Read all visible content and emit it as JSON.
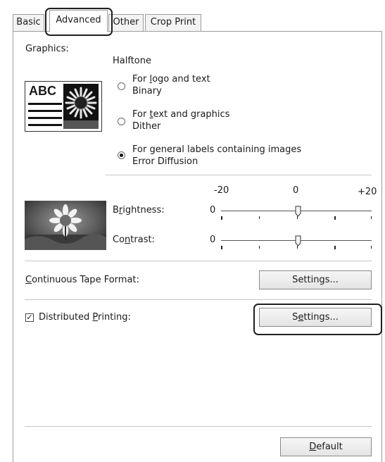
{
  "tabs": [
    {
      "label": "Basic"
    },
    {
      "label": "Advanced"
    },
    {
      "label": "Other"
    },
    {
      "label": "Crop Print"
    }
  ],
  "graphics": {
    "label": "Graphics:",
    "preview_text": "ABC",
    "halftone_label": "Halftone",
    "options": [
      {
        "line1_pre": "For ",
        "line1_mnemonic": "l",
        "line1_post": "ogo and text",
        "line2": "Binary",
        "selected": false
      },
      {
        "line1_pre": "For ",
        "line1_mnemonic": "t",
        "line1_post": "ext and graphics",
        "line2": "Dither",
        "selected": false
      },
      {
        "line1_pre": "For ",
        "line1_mnemonic": "g",
        "line1_post": "eneral labels containing images",
        "line2": "Error Diffusion",
        "selected": true
      }
    ]
  },
  "adjust": {
    "scale_min": "-20",
    "scale_mid": "0",
    "scale_max": "+20",
    "brightness": {
      "label_pre": "B",
      "label_mnemonic": "r",
      "label_post": "ightness:",
      "value": "0",
      "level": 0
    },
    "contrast": {
      "label_pre": "Co",
      "label_mnemonic": "n",
      "label_post": "trast:",
      "value": "0",
      "level": 0
    }
  },
  "continuous_tape": {
    "label_mnemonic": "C",
    "label_post": "ontinuous Tape Format:",
    "button_label": "Settings..."
  },
  "distributed": {
    "checked": true,
    "check_mark": "✓",
    "label_pre": "Distributed ",
    "label_mnemonic": "P",
    "label_post": "rinting:",
    "button_pre": "S",
    "button_mnemonic": "e",
    "button_post": "ttings..."
  },
  "default_button": {
    "mnemonic": "D",
    "rest": "efault"
  }
}
